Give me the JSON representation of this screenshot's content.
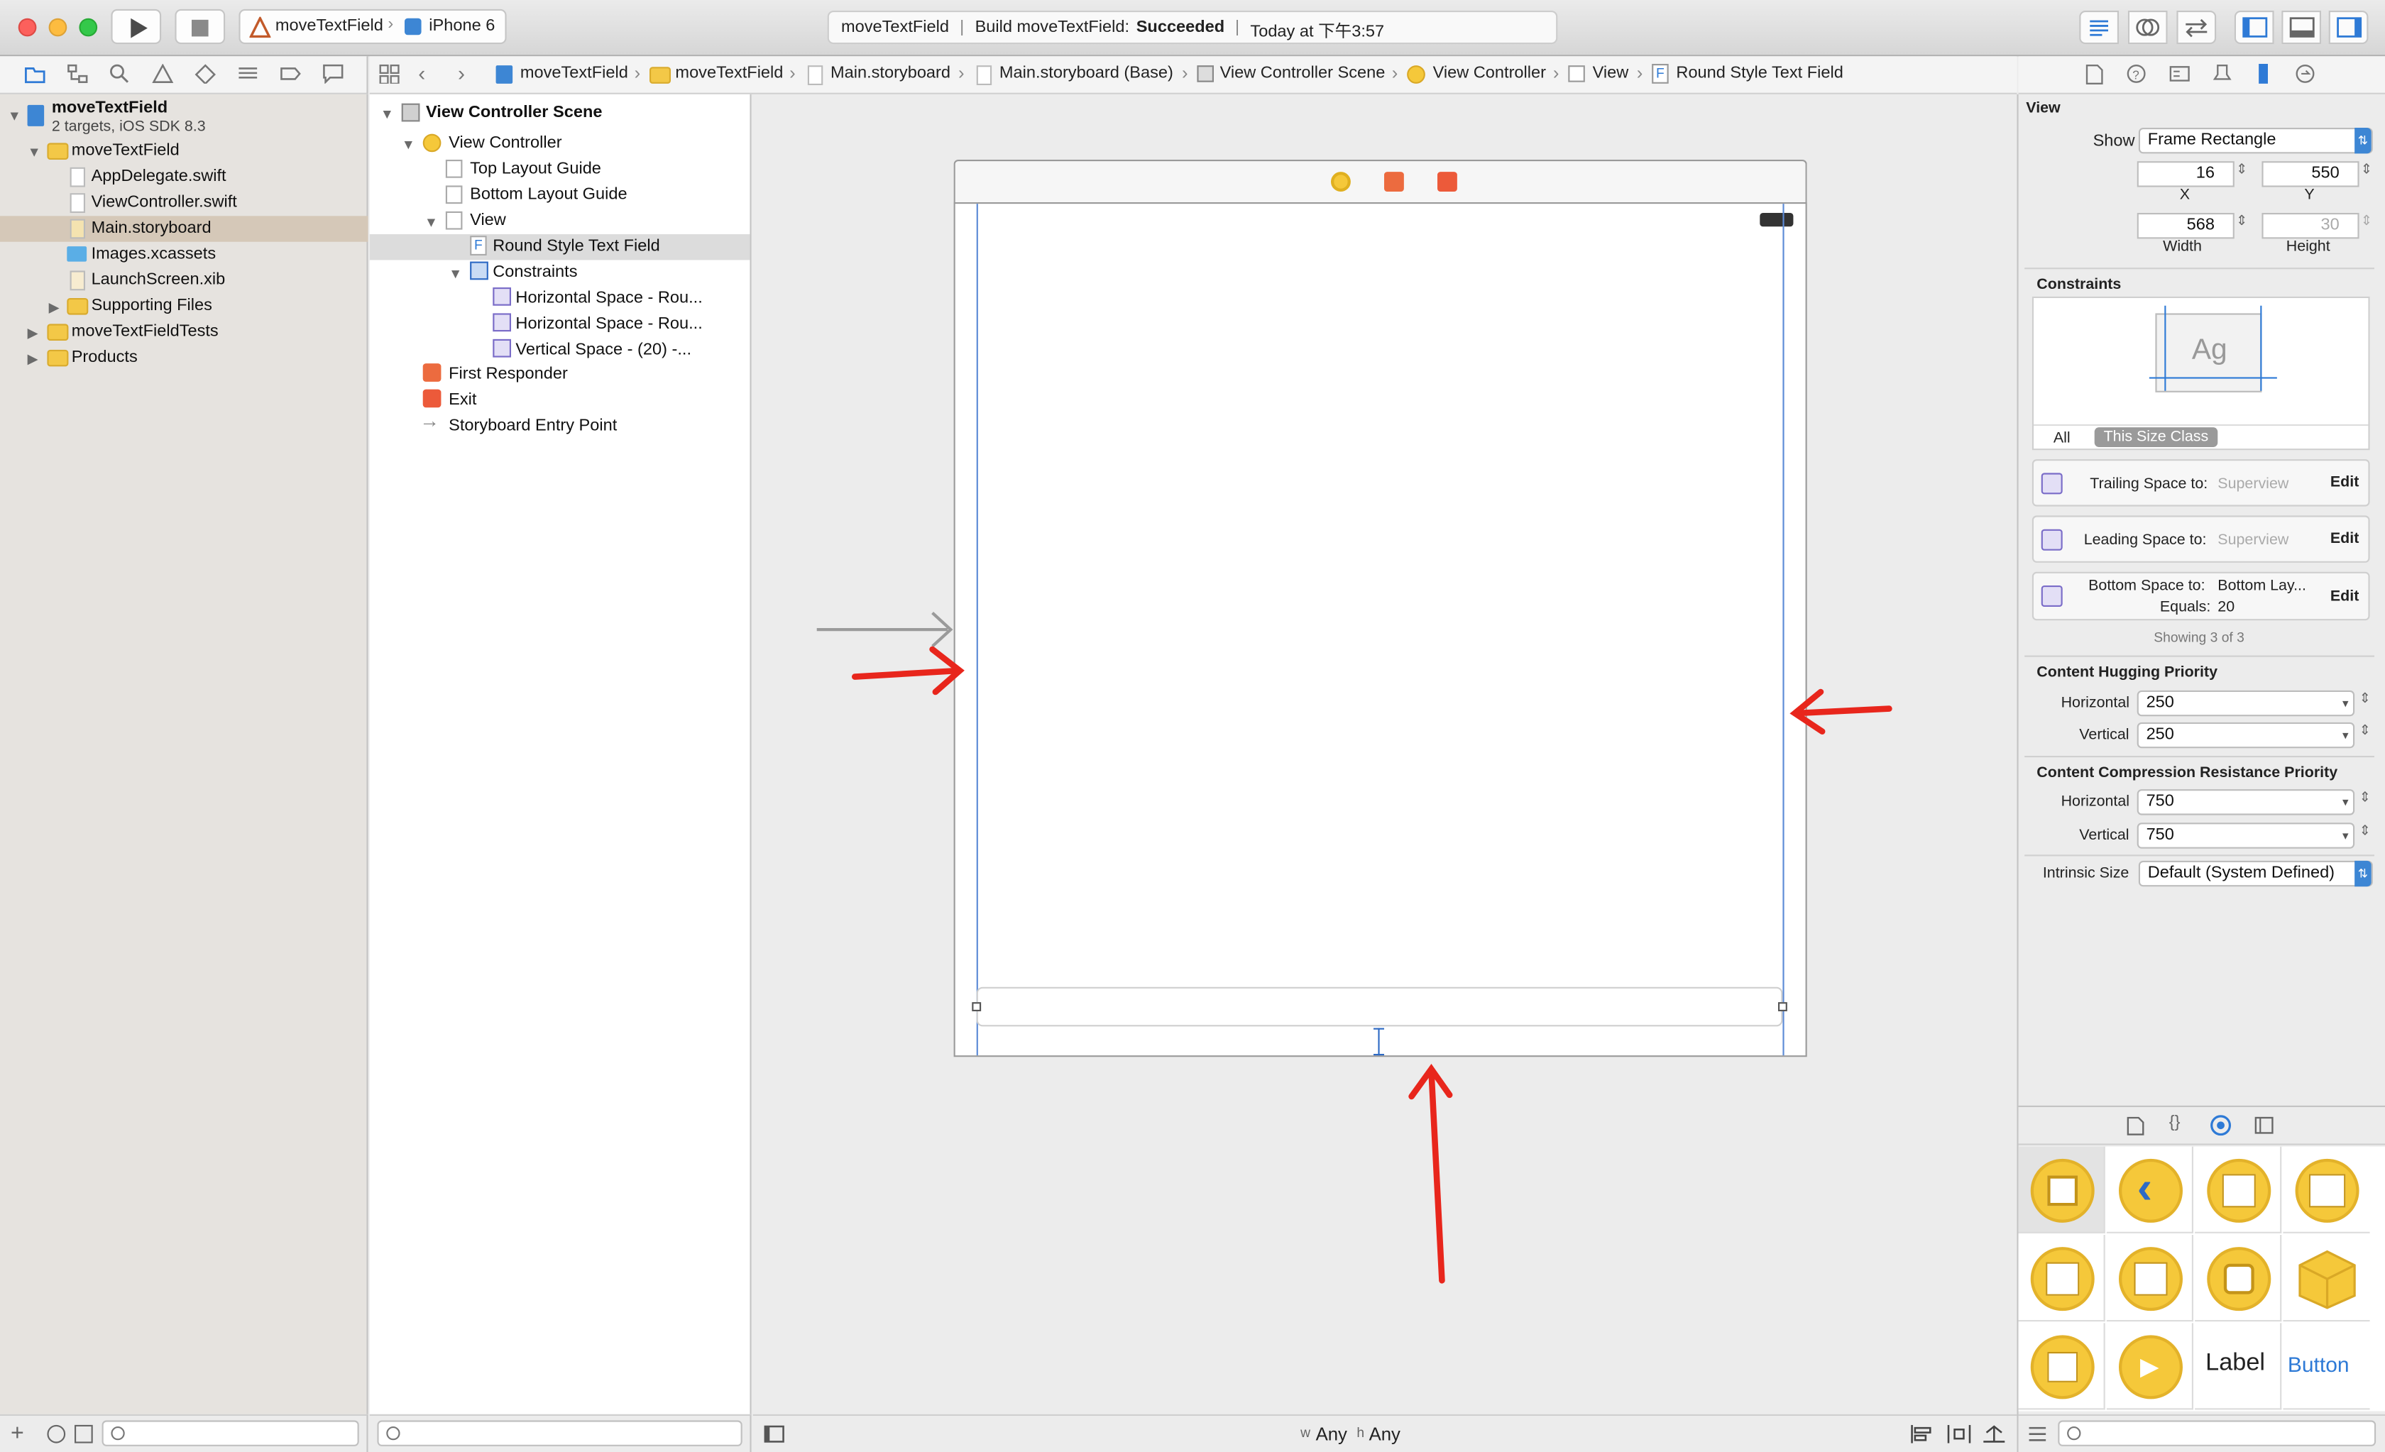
{
  "window": {
    "scheme": "moveTextField",
    "device": "iPhone 6",
    "status_project": "moveTextField",
    "status_build": "Build moveTextField:",
    "status_result": "Succeeded",
    "status_time": "Today at 下午3:57"
  },
  "jump_bar": [
    "moveTextField",
    "moveTextField",
    "Main.storyboard",
    "Main.storyboard (Base)",
    "View Controller Scene",
    "View Controller",
    "View",
    "Round Style Text Field"
  ],
  "navigator": {
    "project_name": "moveTextField",
    "project_subtitle": "2 targets, iOS SDK 8.3",
    "items": [
      "moveTextField",
      "AppDelegate.swift",
      "ViewController.swift",
      "Main.storyboard",
      "Images.xcassets",
      "LaunchScreen.xib",
      "Supporting Files",
      "moveTextFieldTests",
      "Products"
    ]
  },
  "outline": {
    "items": [
      "View Controller Scene",
      "View Controller",
      "Top Layout Guide",
      "Bottom Layout Guide",
      "View",
      "Round Style Text Field",
      "Constraints",
      "Horizontal Space - Rou...",
      "Horizontal Space - Rou...",
      "Vertical Space - (20) -...",
      "First Responder",
      "Exit",
      "Storyboard Entry Point"
    ]
  },
  "canvas": {
    "size_w": "w",
    "size_w_val": "Any",
    "size_h": "h",
    "size_h_val": "Any",
    "annotation_color": "#e8261c"
  },
  "inspector": {
    "section_view": "View",
    "show_label": "Show",
    "show_value": "Frame Rectangle",
    "x_value": "16",
    "y_value": "550",
    "x_label": "X",
    "y_label": "Y",
    "width_value": "568",
    "height_value": "30",
    "width_label": "Width",
    "height_label": "Height",
    "constraints_title": "Constraints",
    "preview_glyph": "Ag",
    "tab_all": "All",
    "tab_size_class": "This Size Class",
    "constraints": [
      {
        "label": "Trailing Space to:",
        "target": "Superview",
        "edit": "Edit"
      },
      {
        "label": "Leading Space to:",
        "target": "Superview",
        "edit": "Edit"
      },
      {
        "label": "Bottom Space to:",
        "target": "Bottom Lay...",
        "equals_label": "Equals:",
        "equals_value": "20",
        "edit": "Edit"
      }
    ],
    "showing": "Showing 3 of 3",
    "hugging_title": "Content Hugging Priority",
    "hugging_h_label": "Horizontal",
    "hugging_h": "250",
    "hugging_v_label": "Vertical",
    "hugging_v": "250",
    "compression_title": "Content Compression Resistance Priority",
    "compression_h_label": "Horizontal",
    "compression_h": "750",
    "compression_v_label": "Vertical",
    "compression_v": "750",
    "intrinsic_label": "Intrinsic Size",
    "intrinsic_value": "Default (System Defined)"
  },
  "library": {
    "label_item": "Label",
    "button_item": "Button"
  }
}
